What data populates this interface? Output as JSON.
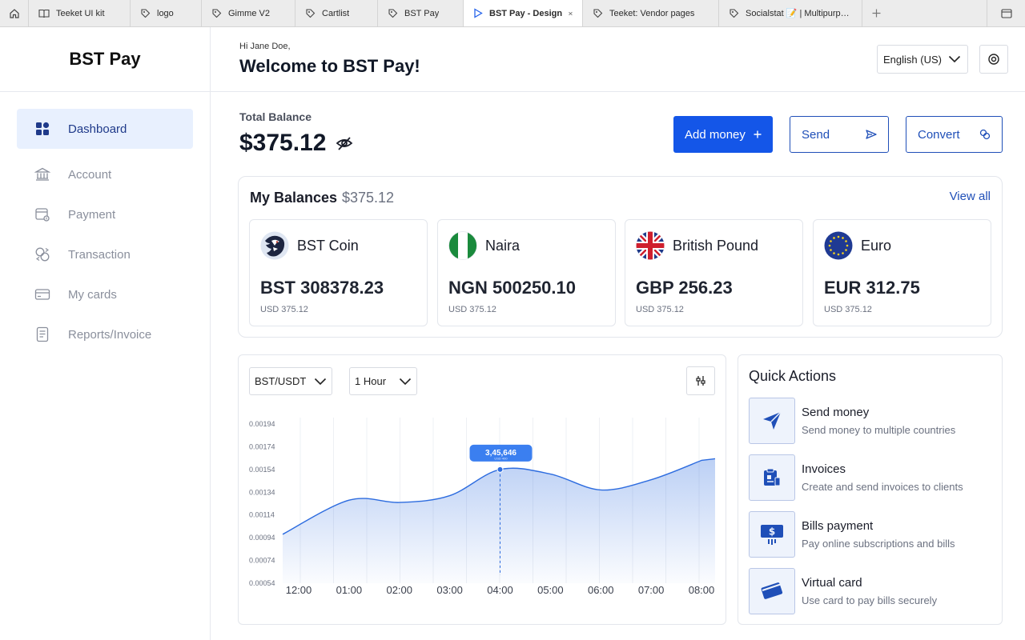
{
  "tabs": [
    {
      "label": "Teeket UI kit",
      "icon": "book-icon"
    },
    {
      "label": "logo",
      "icon": "figma-tag-icon"
    },
    {
      "label": "Gimme V2",
      "icon": "figma-tag-icon"
    },
    {
      "label": "Cartlist",
      "icon": "figma-tag-icon"
    },
    {
      "label": "BST Pay",
      "icon": "figma-tag-icon"
    },
    {
      "label": "BST Pay - Design",
      "icon": "play-icon",
      "active": true
    },
    {
      "label": "Teeket: Vendor pages",
      "icon": "figma-tag-icon"
    },
    {
      "label": "Socialstat 📝 | Multipurpose D",
      "icon": "figma-tag-icon"
    }
  ],
  "brand": "BST Pay",
  "nav": [
    {
      "label": "Dashboard",
      "icon": "dashboard-icon",
      "active": true
    },
    {
      "label": "Account",
      "icon": "bank-icon"
    },
    {
      "label": "Payment",
      "icon": "payment-icon"
    },
    {
      "label": "Transaction",
      "icon": "transaction-icon"
    },
    {
      "label": "My cards",
      "icon": "card-icon"
    },
    {
      "label": "Reports/Invoice",
      "icon": "report-icon"
    }
  ],
  "header": {
    "greeting": "Hi Jane Doe,",
    "welcome": "Welcome to BST Pay!",
    "language": "English (US)"
  },
  "balance": {
    "label": "Total Balance",
    "amount": "$375.12"
  },
  "actions": {
    "add_money": "Add money",
    "send": "Send",
    "convert": "Convert"
  },
  "my_balances": {
    "title": "My Balances",
    "total": "$375.12",
    "view_all": "View all",
    "currencies": [
      {
        "name": "BST Coin",
        "amount": "BST 308378.23",
        "usd": "USD 375.12",
        "flag": "bst-coin-icon"
      },
      {
        "name": "Naira",
        "amount": "NGN 500250.10",
        "usd": "USD 375.12",
        "flag": "nigeria-flag-icon"
      },
      {
        "name": "British Pound",
        "amount": "GBP 256.23",
        "usd": "USD 375.12",
        "flag": "uk-flag-icon"
      },
      {
        "name": "Euro",
        "amount": "EUR 312.75",
        "usd": "USD 375.12",
        "flag": "eu-flag-icon"
      }
    ]
  },
  "chart_controls": {
    "pair": "BST/USDT",
    "interval": "1 Hour"
  },
  "chart_data": {
    "type": "area",
    "title": "",
    "xlabel": "",
    "ylabel": "",
    "x": [
      "12:00",
      "01:00",
      "02:00",
      "03:00",
      "04:00",
      "05:00",
      "06:00",
      "07:00",
      "08:00"
    ],
    "y_ticks": [
      "0.00194",
      "0.00174",
      "0.00154",
      "0.00134",
      "0.00114",
      "0.00094",
      "0.00074",
      "0.00054"
    ],
    "ylim": [
      0.00054,
      0.00194
    ],
    "series": [
      {
        "values": [
          0.00097,
          0.00127,
          0.00125,
          0.00131,
          0.00154,
          0.0015,
          0.00136,
          0.00145,
          0.00162
        ]
      }
    ],
    "tooltip": {
      "x": "04:00",
      "value": "3,45,646",
      "sub": "USD 400"
    },
    "grid": true,
    "color": "#2d6cdf"
  },
  "quick_actions": {
    "title": "Quick Actions",
    "items": [
      {
        "name": "Send money",
        "desc": "Send money to multiple countries",
        "icon": "paper-plane-icon"
      },
      {
        "name": "Invoices",
        "desc": "Create and send invoices to clients",
        "icon": "invoice-icon"
      },
      {
        "name": "Bills payment",
        "desc": "Pay online subscriptions and bills",
        "icon": "bill-icon"
      },
      {
        "name": "Virtual card",
        "desc": "Use card to pay bills securely",
        "icon": "virtual-card-icon"
      }
    ]
  }
}
